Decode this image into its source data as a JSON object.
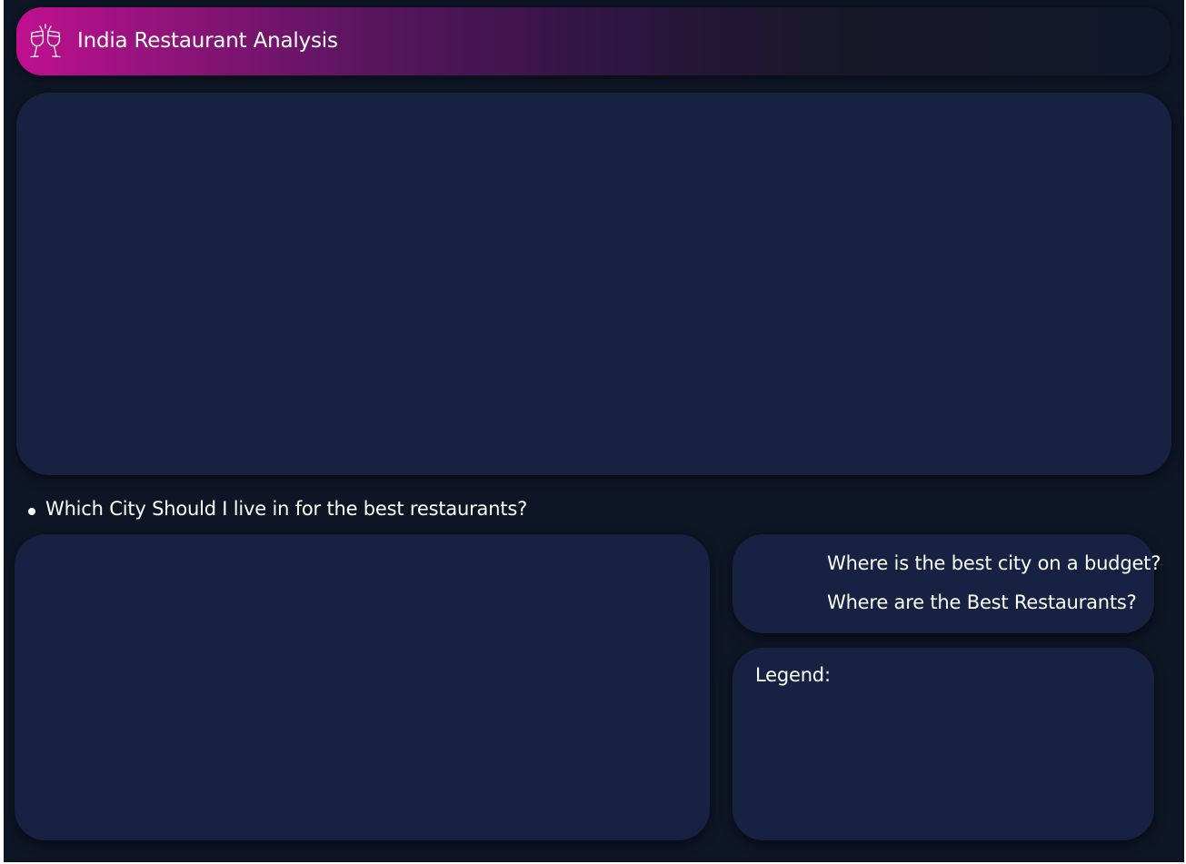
{
  "header": {
    "logo_icon": "cheers-glasses-icon",
    "title": "India Restaurant Analysis",
    "gradient_start": "#c0108f",
    "gradient_end": "#10172a"
  },
  "question": {
    "text": "Which City Should I live in for the best restaurants?"
  },
  "nav_links": [
    {
      "label": "Where is the best city on a budget?"
    },
    {
      "label": "Where are the Best Restaurants?"
    }
  ],
  "legend": {
    "label": "Legend:"
  },
  "colors": {
    "background": "#0e1524",
    "panel": "#172142",
    "text": "#ffffff"
  }
}
